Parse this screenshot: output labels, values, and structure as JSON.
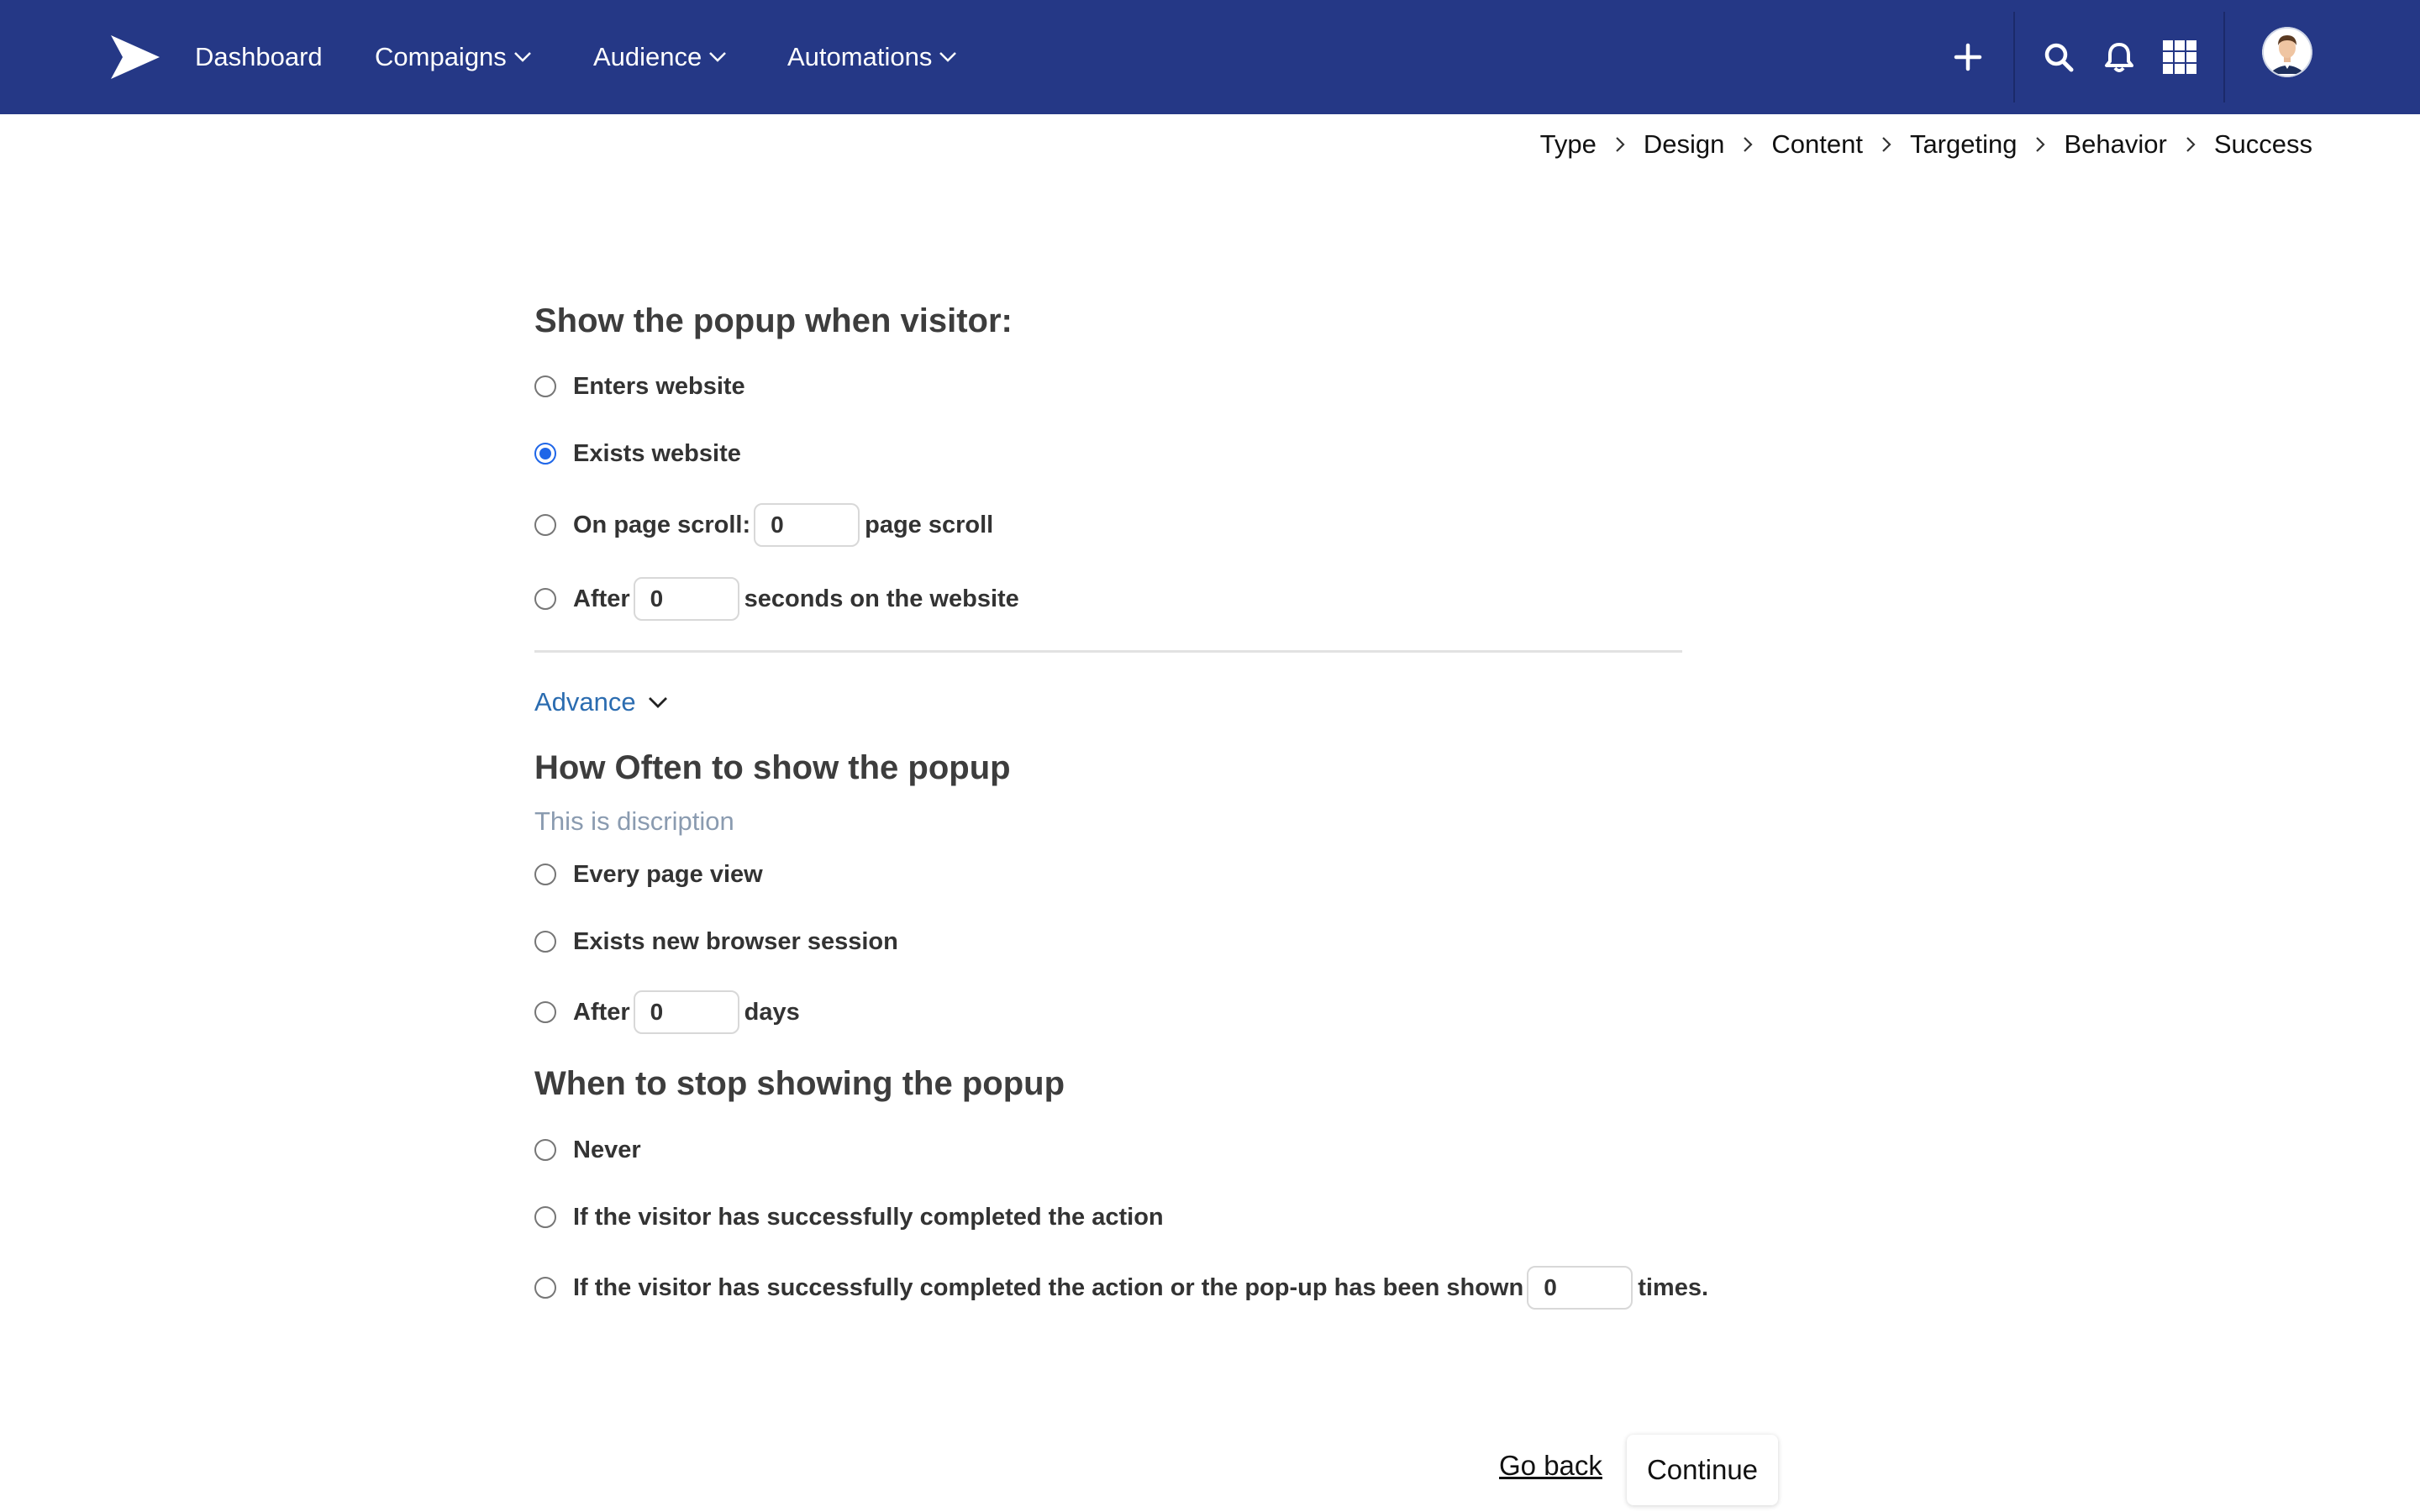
{
  "nav": {
    "dashboard": "Dashboard",
    "campaigns": "Compaigns",
    "audience": "Audience",
    "automations": "Automations"
  },
  "icons": {
    "logo": "paper-plane-logo",
    "add": "plus-icon",
    "search": "search-icon",
    "notifications": "bell-icon",
    "apps": "grid-icon",
    "avatar": "user-avatar"
  },
  "breadcrumb": [
    "Type",
    "Design",
    "Content",
    "Targeting",
    "Behavior",
    "Success"
  ],
  "show_section": {
    "title": "Show the popup when visitor:",
    "enters": "Enters website",
    "exits": "Exists website",
    "scroll_label": "On page scroll:",
    "scroll_value": "0",
    "scroll_suffix": "page scroll",
    "after_label": "After",
    "after_value": "0",
    "after_suffix": "seconds on the website",
    "selected": "exits"
  },
  "advance": {
    "label": "Advance"
  },
  "frequency_section": {
    "title": "How Often to show the popup",
    "description": "This is discription",
    "every_page": "Every page view",
    "new_session": "Exists new browser session",
    "after_label": "After",
    "after_value": "0",
    "after_suffix": "days"
  },
  "stop_section": {
    "title": "When to stop showing the popup",
    "never": "Never",
    "completed": "If the visitor has successfully completed the action",
    "completed_or_shown": "If the visitor has successfully completed the action or the pop-up has been shown",
    "shown_value": "0",
    "shown_suffix": "times."
  },
  "footer": {
    "go_back": "Go back",
    "continue": "Continue"
  },
  "colors": {
    "nav_bg": "#253886",
    "accent": "#1f66e8",
    "link": "#2b6cb0"
  }
}
